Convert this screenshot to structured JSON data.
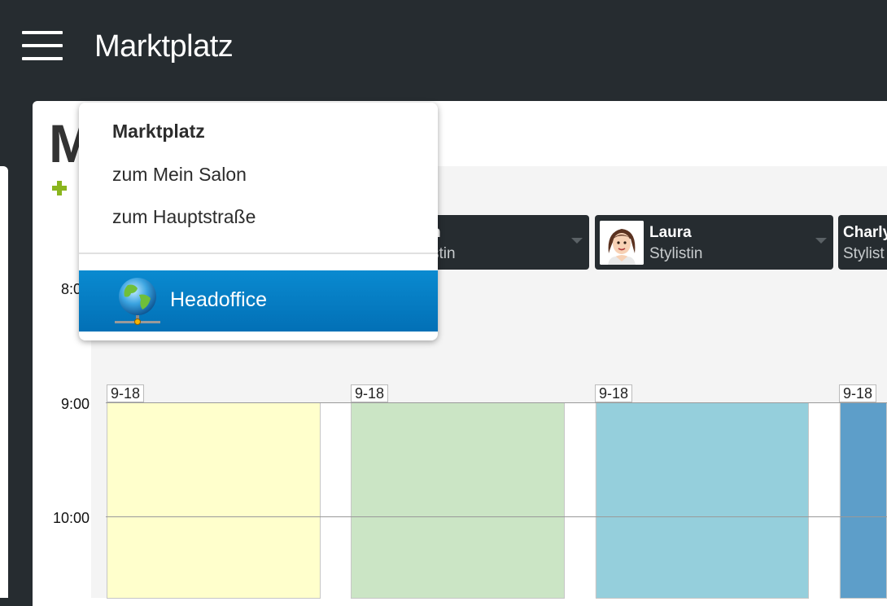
{
  "topbar": {
    "title": "Marktplatz"
  },
  "card": {
    "title": "M"
  },
  "menu": {
    "header": "Marktplatz",
    "items": [
      "zum Mein Salon",
      "zum Hauptstraße"
    ],
    "active_label": "Headoffice",
    "active_icon": "globe-network-icon",
    "active_color": "#0280c4"
  },
  "staff": [
    {
      "name": "n",
      "role": "stin"
    },
    {
      "name": "Laura",
      "role": "Stylistin"
    },
    {
      "name": "Charly",
      "role": "Stylist"
    }
  ],
  "times": [
    "8:0",
    "9:00",
    "10:00"
  ],
  "shift": "9-18",
  "column_colors": [
    "#ffffcc",
    "#cbe5c5",
    "#95cfdc",
    "#5d9ec9"
  ]
}
